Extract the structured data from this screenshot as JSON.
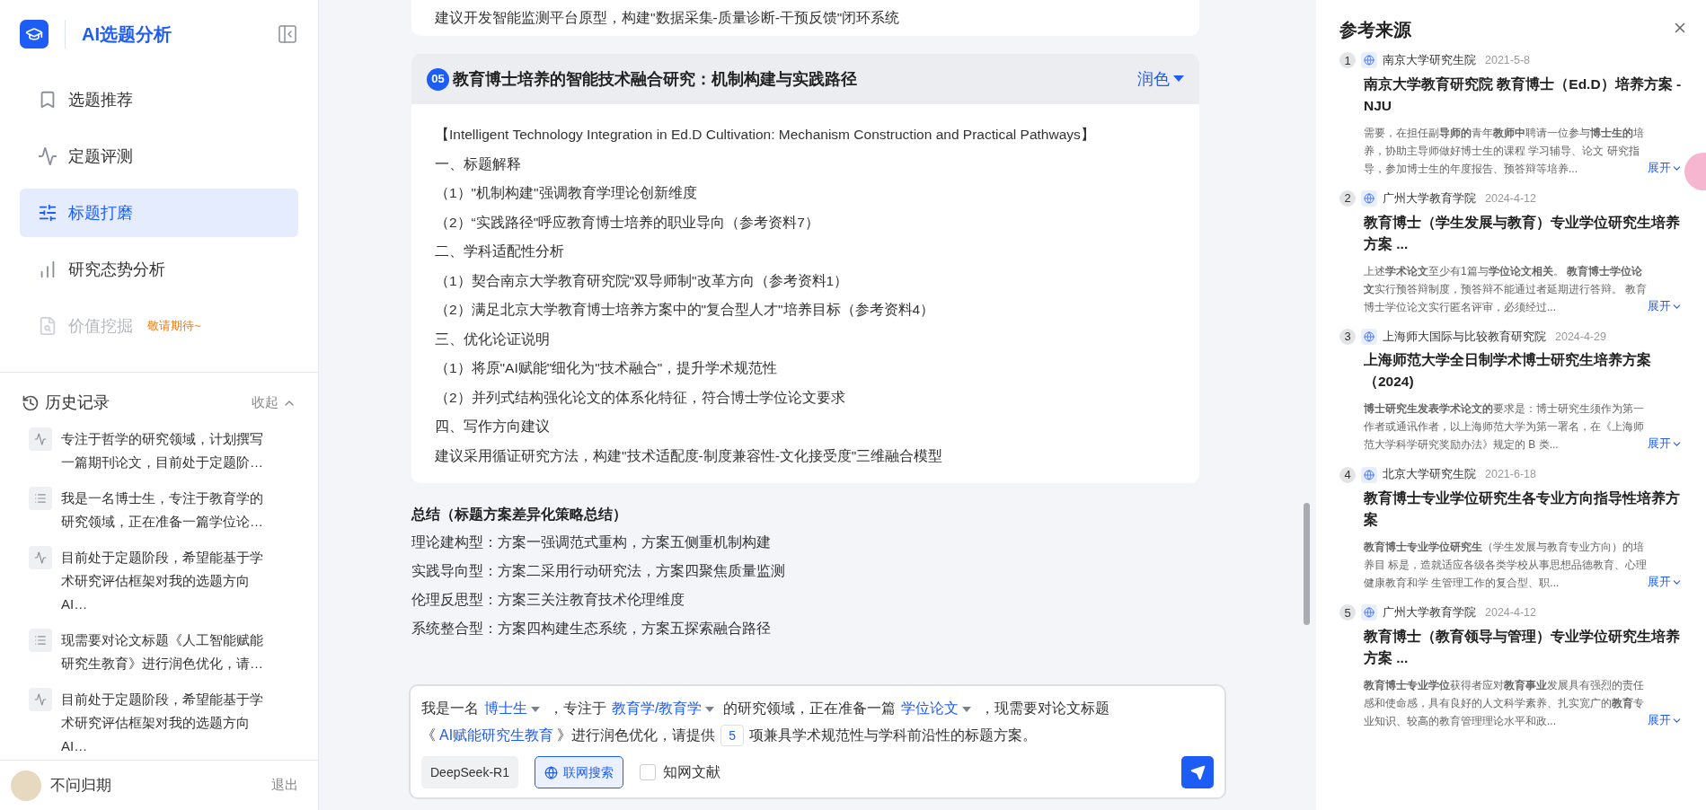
{
  "sidebar": {
    "app_title": "AI选题分析",
    "nav": [
      {
        "label": "选题推荐",
        "selected": false,
        "disabled": false
      },
      {
        "label": "定题评测",
        "selected": false,
        "disabled": false
      },
      {
        "label": "标题打磨",
        "selected": true,
        "disabled": false
      },
      {
        "label": "研究态势分析",
        "selected": false,
        "disabled": false
      },
      {
        "label": "价值挖掘",
        "selected": false,
        "disabled": true,
        "badge": "敬请期待~"
      }
    ],
    "history": {
      "title": "历史记录",
      "toggle": "收起",
      "items": [
        {
          "kind": "evaluation",
          "text": "专注于哲学的研究领域，计划撰写一篇期刊论文，目前处于定题阶…"
        },
        {
          "kind": "polish",
          "text": "我是一名博士生，专注于教育学的研究领域，正在准备一篇学位论…"
        },
        {
          "kind": "evaluation",
          "text": "目前处于定题阶段，希望能基于学术研究评估框架对我的选题方向AI…"
        },
        {
          "kind": "polish",
          "text": "现需要对论文标题《人工智能赋能研究生教育》进行润色优化，请…"
        },
        {
          "kind": "evaluation",
          "text": "目前处于定题阶段，希望能基于学术研究评估框架对我的选题方向AI…"
        }
      ]
    },
    "user": {
      "name": "不问归期",
      "logout": "退出"
    }
  },
  "main": {
    "previous_tail": "建议开发智能监测平台原型，构建\"数据采集-质量诊断-干预反馈\"闭环系统",
    "card": {
      "number": "05",
      "title": "教育博士培养的智能技术融合研究：机制构建与实践路径",
      "action": "润色",
      "lines": [
        "【Intelligent Technology Integration in Ed.D Cultivation: Mechanism Construction and Practical Pathways】",
        "一、标题解释",
        "（1）\"机制构建\"强调教育学理论创新维度",
        "（2）“实践路径\"呼应教育博士培养的职业导向（参考资料7）",
        "二、学科适配性分析",
        "（1）契合南京大学教育研究院\"双导师制\"改革方向（参考资料1）",
        "（2）满足北京大学教育博士培养方案中的\"复合型人才\"培养目标（参考资料4）",
        "三、优化论证说明",
        "（1）将原\"AI赋能\"细化为\"技术融合\"，提升学术规范性",
        "（2）并列式结构强化论文的体系化特征，符合博士学位论文要求",
        "四、写作方向建议",
        "建议采用循证研究方法，构建\"技术适配度-制度兼容性-文化接受度\"三维融合模型"
      ]
    },
    "summary": {
      "title": "总结（标题方案差异化策略总结）",
      "lines": [
        "理论建构型：方案一强调范式重构，方案五侧重机制构建",
        "实践导向型：方案二采用行动研究法，方案四聚焦质量监测",
        "伦理反思型：方案三关注教育技术伦理维度",
        "系统整合型：方案四构建生态系统，方案五探索融合路径"
      ]
    }
  },
  "composer": {
    "parts": [
      {
        "kind": "text",
        "text": "我是一名"
      },
      {
        "kind": "select",
        "text": "博士生"
      },
      {
        "kind": "text",
        "text": "，专注于"
      },
      {
        "kind": "select",
        "text": "教育学/教育学"
      },
      {
        "kind": "text",
        "text": "的研究领域，正在准备一篇"
      },
      {
        "kind": "select",
        "text": "学位论文"
      },
      {
        "kind": "text",
        "text": "，现需要对论文标题"
      },
      {
        "kind": "text",
        "text": "《"
      },
      {
        "kind": "link",
        "text": "AI赋能研究生教育"
      },
      {
        "kind": "text",
        "text": "》进行润色优化，请提供"
      },
      {
        "kind": "field",
        "text": "5"
      },
      {
        "kind": "text",
        "text": "项兼具学术规范性与学科前沿性的标题方案。"
      }
    ],
    "model": "DeepSeek-R1",
    "web_search": {
      "label": "联网搜索",
      "on": true
    },
    "cnki": {
      "label": "知网文献",
      "checked": false
    }
  },
  "sources": {
    "title": "参考来源",
    "items": [
      {
        "number": "1",
        "site": "南京大学研究生院",
        "date": "2021-5-8",
        "title": "南京大学教育研究院 教育博士（Ed.D）培养方案 - NJU",
        "snippet": "需要，在担任副**导师的**青年**教师中**聘请一位参与**博士生的**培养，协助主导师做好博士生的课程 学习辅导、论文 研究指导，参加博士生的年度报告、预答辩等培养...",
        "expand": "展开"
      },
      {
        "number": "2",
        "site": "广州大学教育学院",
        "date": "2024-4-12",
        "title": "教育博士（学生发展与教育）专业学位研究生培养方案 ...",
        "snippet": "上述**学术论文**至少有1篇与**学位论文相关**。 **教育博士学位论文**实行预答辩制度，预答辩不能通过者延期进行答辩。 教育博士学位论文实行匿名评审，必须经过...",
        "expand": "展开"
      },
      {
        "number": "3",
        "site": "上海师大国际与比较教育研究院",
        "date": "2024-4-29",
        "title": "上海师范大学全日制学术博士研究生培养方案（2024)",
        "snippet": "**博士研究生发表学术论文的**要求是：博士研究生须作为第一作者或通讯作者，以上海师范大学为第一署名，在《上海师范大学科学研究奖励办法》规定的 B 类...",
        "expand": "展开"
      },
      {
        "number": "4",
        "site": "北京大学研究生院",
        "date": "2021-6-18",
        "title": "教育博士专业学位研究生各专业方向指导性培养方案",
        "snippet": "**教育博士专业学位研究生**（学生发展与教育专业方向）的培养目 标是，造就适应各级各类学校从事思想品德教育、心理健康教育和学 生管理工作的复合型、职...",
        "expand": "展开"
      },
      {
        "number": "5",
        "site": "广州大学教育学院",
        "date": "2024-4-12",
        "title": "教育博士（教育领导与管理）专业学位研究生培养方案 ...",
        "snippet": "**教育博士专业学位**获得者应对**教育事业**发展具有强烈的责任感和使命感，具有良好的人文科学素养、扎实宽广的**教育**专业知识、较高的教育管理理论水平和政...",
        "expand": "展开"
      }
    ]
  }
}
